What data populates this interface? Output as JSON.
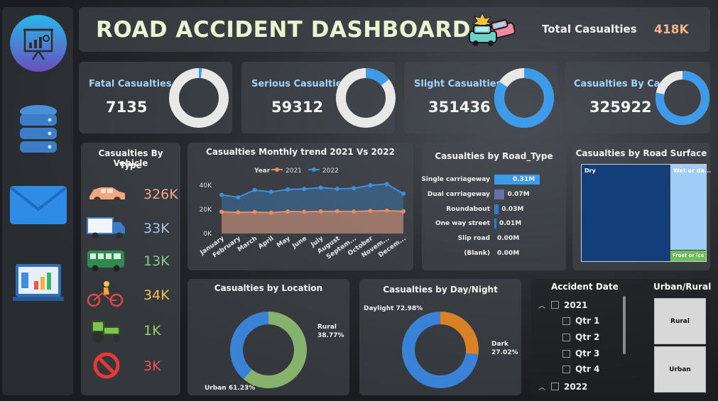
{
  "header": {
    "title": "ROAD ACCIDENT DASHBOARD",
    "total_label": "Total Casualties",
    "total_value": "418K"
  },
  "sidebar": {
    "icons": [
      "presentation-board-icon",
      "database-icon",
      "mail-icon",
      "report-chart-icon"
    ]
  },
  "kpis": [
    {
      "title": "Fatal Casualties",
      "value": "7135",
      "share": 0.017
    },
    {
      "title": "Serious Casualties",
      "value": "59312",
      "share": 0.142
    },
    {
      "title": "Slight Casualties",
      "value": "351436",
      "share": 0.841
    },
    {
      "title": "Casualties By Car",
      "value": "325922",
      "share": 0.78
    }
  ],
  "vehicle_panel": {
    "title_line1": "Casualties By Vehicle",
    "title_line2": "Type",
    "rows": [
      {
        "icon": "car-icon",
        "value": "326K",
        "color": "#f4a582"
      },
      {
        "icon": "truck-icon",
        "value": "33K",
        "color": "#9fc6ea"
      },
      {
        "icon": "bus-icon",
        "value": "13K",
        "color": "#84c98a"
      },
      {
        "icon": "bicycle-icon",
        "value": "34K",
        "color": "#f2c14e"
      },
      {
        "icon": "tractor-icon",
        "value": "1K",
        "color": "#8fd36a"
      },
      {
        "icon": "no-entry-icon",
        "value": "3K",
        "color": "#ef5350"
      }
    ]
  },
  "trend": {
    "title": "Casualties Monthly trend 2021 Vs 2022",
    "legend_title": "Year",
    "series_names": [
      "2021",
      "2022"
    ],
    "colors": [
      "#e88d5f",
      "#3d8fe0"
    ],
    "y_ticks": [
      "40K",
      "20K",
      "0K"
    ],
    "months": [
      "January",
      "February",
      "March",
      "April",
      "May",
      "June",
      "July",
      "August",
      "Septem...",
      "October",
      "Novem...",
      "Decem..."
    ]
  },
  "chart_data": [
    {
      "type": "line",
      "title": "Casualties Monthly trend 2021 Vs 2022",
      "categories": [
        "January",
        "February",
        "March",
        "April",
        "May",
        "June",
        "July",
        "August",
        "September",
        "October",
        "November",
        "December"
      ],
      "series": [
        {
          "name": "2021",
          "values": [
            18000,
            17500,
            17800,
            17300,
            18200,
            18000,
            18300,
            18400,
            18200,
            18700,
            18900,
            18400
          ]
        },
        {
          "name": "2022",
          "values": [
            32000,
            30000,
            36000,
            34500,
            36500,
            37000,
            38000,
            37000,
            37500,
            40000,
            41000,
            33000
          ]
        }
      ],
      "ylim": [
        0,
        45000
      ]
    },
    {
      "type": "bar",
      "title": "Casualties by Road_Type",
      "categories": [
        "Single carriageway",
        "Dual carriageway",
        "Roundabout",
        "One way street",
        "Slip road",
        "(Blank)"
      ],
      "values": [
        0.31,
        0.07,
        0.03,
        0.01,
        0.0,
        0.0
      ],
      "value_labels": [
        "0.31M",
        "0.07M",
        "0.03M",
        "0.01M",
        "0.00M",
        "0.00M"
      ],
      "colors": [
        "#3d9be9",
        "#6a6fa8",
        "#2f7dd1",
        "#2f7dd1",
        "#2f7dd1",
        "#2f7dd1"
      ]
    },
    {
      "type": "pie",
      "title": "Casualties by Location",
      "labels": [
        "Urban",
        "Rural"
      ],
      "values": [
        61.23,
        38.77
      ],
      "value_labels": [
        "61.23%",
        "38.77%"
      ],
      "colors": [
        "#86b26e",
        "#3a82d6"
      ]
    },
    {
      "type": "pie",
      "title": "Casualties by Day/Night",
      "labels": [
        "Daylight",
        "Dark"
      ],
      "values": [
        72.98,
        27.02
      ],
      "value_labels": [
        "72.98%",
        "27.02%"
      ],
      "colors": [
        "#3a82d6",
        "#d88127"
      ]
    }
  ],
  "road_surface": {
    "title": "Casualties by Road Surface",
    "tiles": [
      {
        "label": "Dry",
        "color": "#123e7a"
      },
      {
        "label": "Wet or da...",
        "color": "#9fcdf7"
      },
      {
        "label": "Frost or ice",
        "color": "#6fbe5e"
      }
    ]
  },
  "slicer": {
    "title": "Accident Date",
    "items": [
      {
        "label": "2021",
        "level": 0,
        "expanded": true
      },
      {
        "label": "Qtr 1",
        "level": 1
      },
      {
        "label": "Qtr 2",
        "level": 1
      },
      {
        "label": "Qtr 3",
        "level": 1
      },
      {
        "label": "Qtr 4",
        "level": 1
      },
      {
        "label": "2022",
        "level": 0,
        "expanded": true
      }
    ]
  },
  "urban_rural": {
    "title": "Urban/Rural",
    "buttons": [
      "Rural",
      "Urban"
    ]
  }
}
